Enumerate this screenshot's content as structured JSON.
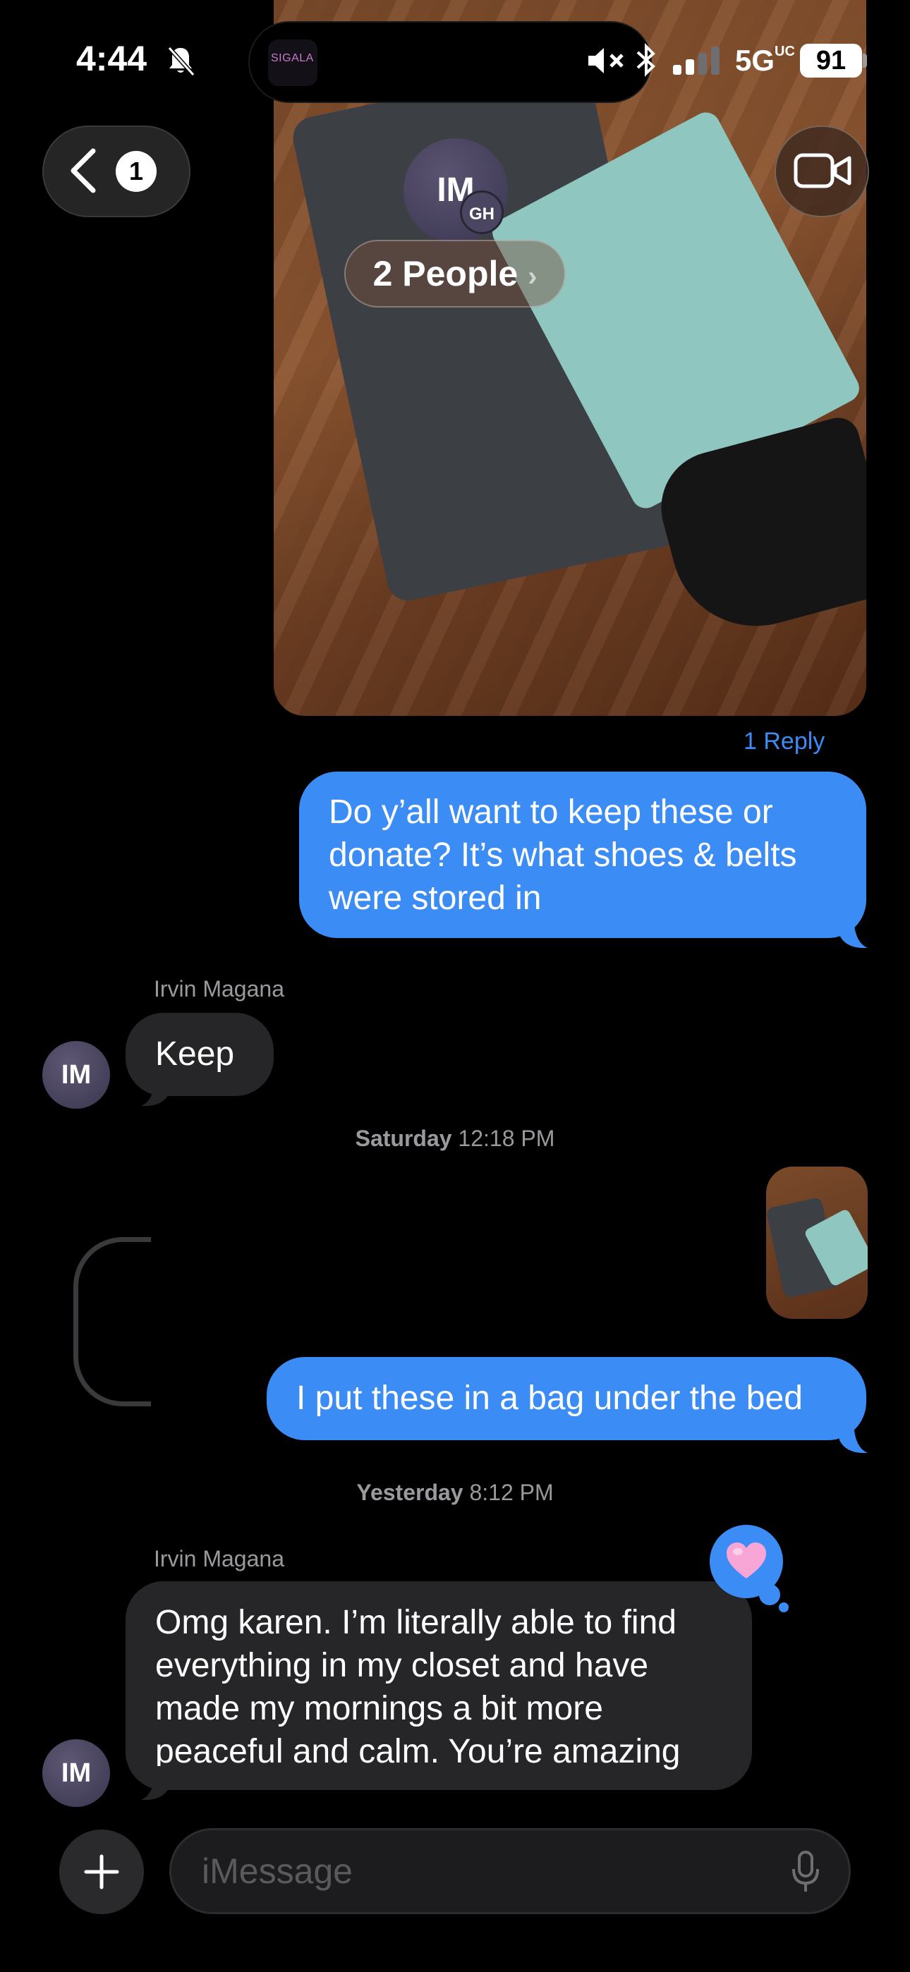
{
  "status_bar": {
    "time": "4:44",
    "island_app_label": "SIGALA",
    "network": "5G",
    "network_suffix": "UC",
    "battery": "91"
  },
  "header": {
    "back_count": "1",
    "avatar_initials": "IM",
    "avatar_sub_initials": "GH",
    "people_label": "2 People",
    "people_chevron": "›"
  },
  "messages": {
    "reply_link": "1 Reply",
    "m1_text": "Do y’all want to keep these or donate? It’s what shoes & belts were stored in",
    "sender_1": "Irvin Magana",
    "m2_text": "Keep",
    "avatar_1": "IM",
    "timestamp_1_day": "Saturday",
    "timestamp_1_time": "12:18 PM",
    "m3_text": "I put these in a bag under the bed",
    "timestamp_2_day": "Yesterday",
    "timestamp_2_time": "8:12 PM",
    "sender_2": "Irvin Magana",
    "m4_text": "Omg karen. I’m literally able to find everything in my closet and have made my mornings a bit more peaceful and calm. You’re amazing",
    "avatar_2": "IM",
    "tapback": "heart"
  },
  "compose": {
    "placeholder": "iMessage"
  },
  "colors": {
    "imessage_blue": "#3b8cf5",
    "gray_bubble": "#262628",
    "background": "#000000",
    "tapback_heart": "#f7a6d6"
  },
  "icons": [
    "bell-slash-icon",
    "mute-icon",
    "bluetooth-icon",
    "signal-icon",
    "chevron-left-icon",
    "video-camera-icon",
    "heart-icon",
    "plus-icon",
    "microphone-icon"
  ]
}
